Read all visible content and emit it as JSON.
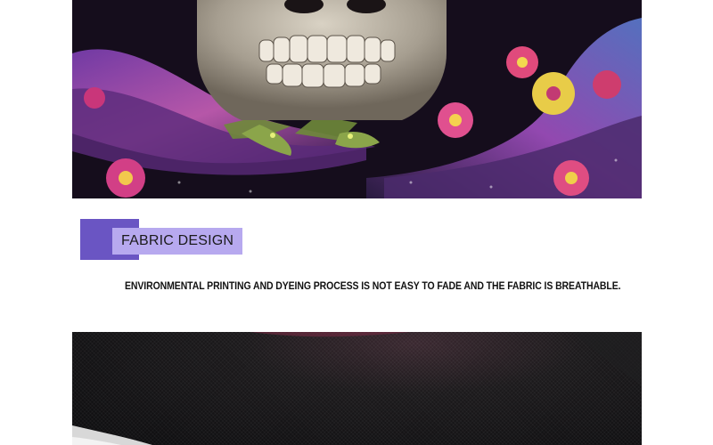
{
  "colors": {
    "label_block": "#6a55c3",
    "label_plate": "#b7a9ef"
  },
  "section": {
    "title": "FABRIC DESIGN",
    "description": "ENVIRONMENTAL PRINTING AND DYEING PROCESS IS NOT EASY TO FADE AND THE FABRIC IS BREATHABLE."
  }
}
